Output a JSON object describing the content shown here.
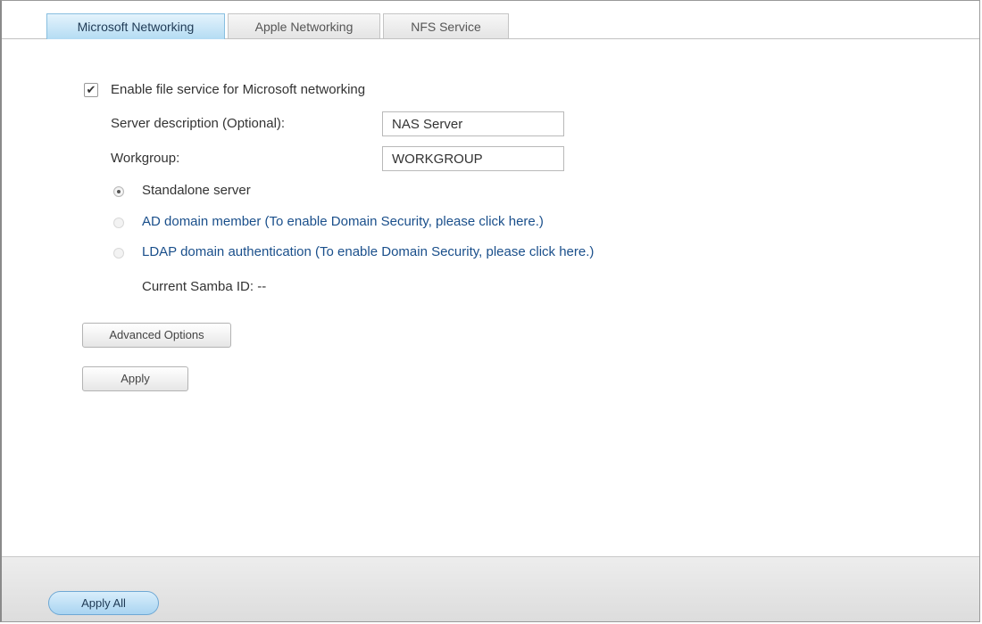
{
  "tabs": [
    {
      "label": "Microsoft Networking",
      "active": true
    },
    {
      "label": "Apple Networking",
      "active": false
    },
    {
      "label": "NFS Service",
      "active": false
    }
  ],
  "form": {
    "enable_label": "Enable file service for Microsoft networking",
    "enable_checked": true,
    "server_description_label": "Server description (Optional):",
    "server_description_value": "NAS Server",
    "workgroup_label": "Workgroup:",
    "workgroup_value": "WORKGROUP",
    "options": [
      {
        "label": "Standalone server",
        "selected": true
      },
      {
        "label": "AD domain member (To enable Domain Security, please click here.)",
        "selected": false
      },
      {
        "label": "LDAP domain authentication (To enable Domain Security, please click here.)",
        "selected": false
      }
    ],
    "samba_id_text": "Current Samba ID: --"
  },
  "buttons": {
    "advanced_label": "Advanced Options",
    "apply_label": "Apply",
    "apply_all_label": "Apply All"
  },
  "colors": {
    "link": "#1a4f8b",
    "tab_active": "#b4dcf3",
    "accent_button": "#a9d4f1"
  }
}
